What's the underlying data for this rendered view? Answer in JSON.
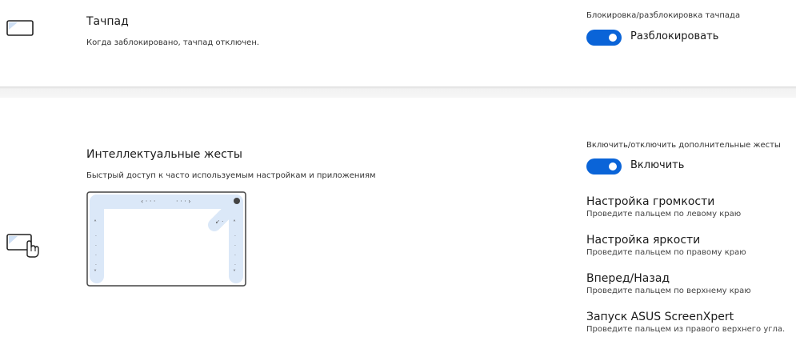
{
  "touchpad": {
    "title": "Тачпад",
    "description": "Когда заблокировано, тачпад отключен.",
    "toggle_caption": "Блокировка/разблокировка тачпада",
    "toggle_label": "Разблокировать",
    "toggle_on": true
  },
  "gestures": {
    "title": "Интеллектуальные жесты",
    "description": "Быстрый доступ к часто используемым настройкам и приложениям",
    "toggle_caption": "Включить/отключить дополнительные жесты",
    "toggle_label": "Включить",
    "toggle_on": true,
    "items": [
      {
        "title": "Настройка громкости",
        "desc": "Проведите пальцем по левому краю"
      },
      {
        "title": "Настройка яркости",
        "desc": "Проведите пальцем по правому краю"
      },
      {
        "title": "Вперед/Назад",
        "desc": "Проведите пальцем по верхнему краю"
      },
      {
        "title": "Запуск ASUS ScreenXpert",
        "desc": "Проведите пальцем из правого верхнего угла."
      }
    ]
  },
  "colors": {
    "accent": "#0a64d8",
    "diagram_highlight": "#dbe8f8",
    "icon_fill": "#cfe0f5"
  },
  "icons": {
    "touchpad": "touchpad-icon",
    "gesture": "touchpad-gesture-icon"
  }
}
